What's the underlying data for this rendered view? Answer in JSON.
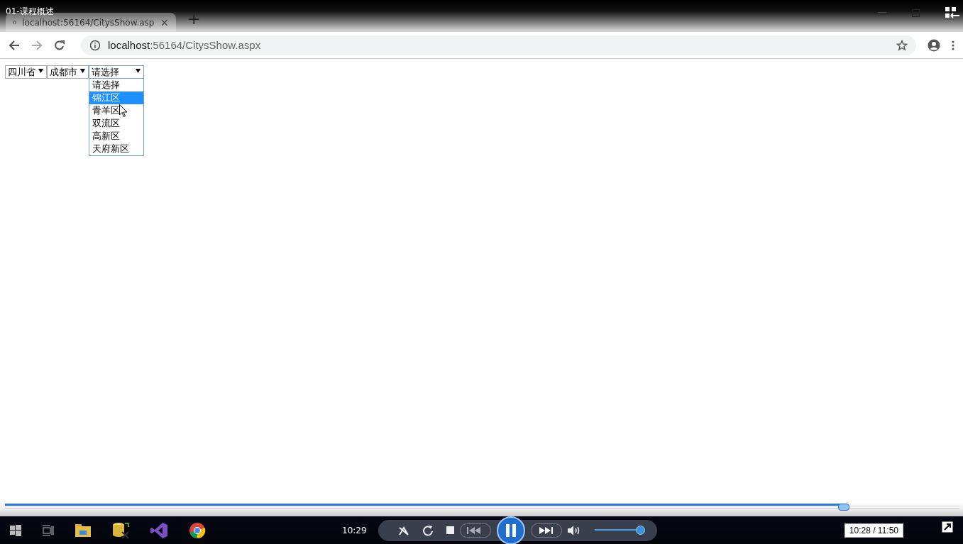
{
  "video_title": "01-课程概述",
  "browser": {
    "tab": {
      "title": "localhost:56164/CitysShow.asp",
      "close": "×"
    },
    "new_tab": "+",
    "address": {
      "host": "localhost",
      "rest": ":56164/CitysShow.aspx"
    }
  },
  "page": {
    "selects": [
      {
        "value": "四川省",
        "open": false
      },
      {
        "value": "成都市",
        "open": false
      },
      {
        "value": "请选择",
        "open": true
      }
    ],
    "options": [
      {
        "label": "请选择",
        "selected": false
      },
      {
        "label": "锦江区",
        "selected": true
      },
      {
        "label": "青羊区",
        "selected": false
      },
      {
        "label": "双流区",
        "selected": false
      },
      {
        "label": "高新区",
        "selected": false
      },
      {
        "label": "天府新区",
        "selected": false
      }
    ]
  },
  "player": {
    "seek": {
      "level": 0.878
    },
    "clock": "10:29",
    "volume": {
      "level": 0.95
    },
    "time": "10:28 / 11:50"
  }
}
